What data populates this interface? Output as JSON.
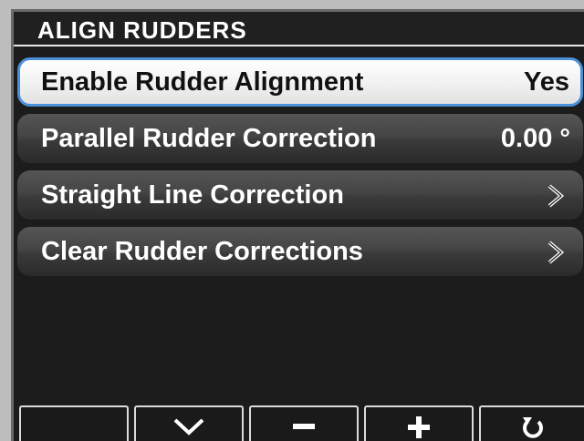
{
  "header": {
    "title": "ALIGN RUDDERS"
  },
  "menu": {
    "items": [
      {
        "label": "Enable Rudder Alignment",
        "value": "Yes",
        "selected": true,
        "icon": null
      },
      {
        "label": "Parallel Rudder Correction",
        "value": "0.00 °",
        "selected": false,
        "icon": null
      },
      {
        "label": "Straight Line Correction",
        "value": "",
        "selected": false,
        "icon": "chevron-right-icon"
      },
      {
        "label": "Clear Rudder Corrections",
        "value": "",
        "selected": false,
        "icon": "chevron-right-icon"
      }
    ]
  },
  "softkeys": [
    {
      "name": "softkey-1",
      "icon": null
    },
    {
      "name": "softkey-down",
      "icon": "chevron-down-icon"
    },
    {
      "name": "softkey-minus",
      "icon": "minus-icon"
    },
    {
      "name": "softkey-plus",
      "icon": "plus-icon"
    },
    {
      "name": "softkey-back",
      "icon": "return-arrow-icon"
    }
  ],
  "colors": {
    "selection_border": "#4a90d8",
    "screen_background": "#1c1c1c",
    "text": "#ffffff"
  }
}
